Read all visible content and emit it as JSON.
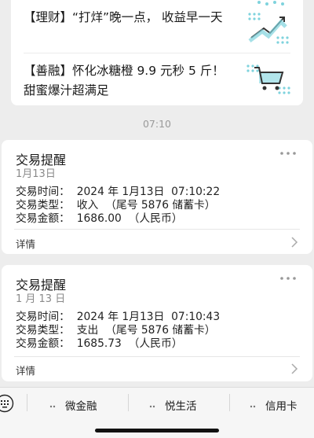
{
  "promos": [
    {
      "tag": "【理财】",
      "text": "“打烊”晚一点， 收益早一天",
      "thumb_icon": "growth-chart-icon"
    },
    {
      "tag": "【善融】",
      "text": "怀化冰糖橙 9.9 元秒 5 斤！ 甜蜜爆汁超满足",
      "thumb_icon": "shopping-cart-icon"
    }
  ],
  "timestamp": "07:10",
  "messages": [
    {
      "title": "交易提醒",
      "date": "1月13日",
      "time_line": "交易时间：  2024 年 1月13日  07:10:22",
      "type_line": "交易类型：  收入  （尾号 5876 储蓄卡）",
      "amount_line": "交易金额：  1686.00  （人民币）",
      "details_label": "详情"
    },
    {
      "title": "交易提醒",
      "date": "1 月 13 日",
      "time_line": "交易时间：  2024 年 1月13日  07:10:43",
      "type_line": "交易类型：  支出  （尾号 5876 储蓄卡）",
      "amount_line": "交易金额：  1685.73  （人民币）",
      "details_label": "详情"
    }
  ],
  "bottom_menu": {
    "items": [
      {
        "label": "微金融"
      },
      {
        "label": "悦生活"
      },
      {
        "label": "信用卡"
      }
    ]
  },
  "colors": {
    "thumb_accent": "#7fd3dd",
    "background": "#ededed",
    "card": "#ffffff"
  }
}
